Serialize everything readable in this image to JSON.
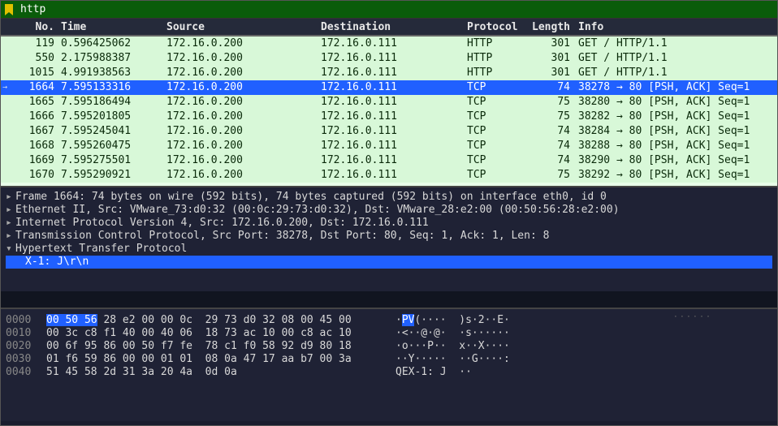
{
  "filter": {
    "value": "http"
  },
  "columns": {
    "no": "No.",
    "time": "Time",
    "source": "Source",
    "destination": "Destination",
    "protocol": "Protocol",
    "length": "Length",
    "info": "Info"
  },
  "packets": [
    {
      "no": "119",
      "time": "0.596425062",
      "src": "172.16.0.200",
      "dst": "172.16.0.111",
      "proto": "HTTP",
      "len": "301",
      "info": "GET / HTTP/1.1",
      "selected": false
    },
    {
      "no": "550",
      "time": "2.175988387",
      "src": "172.16.0.200",
      "dst": "172.16.0.111",
      "proto": "HTTP",
      "len": "301",
      "info": "GET / HTTP/1.1",
      "selected": false
    },
    {
      "no": "1015",
      "time": "4.991938563",
      "src": "172.16.0.200",
      "dst": "172.16.0.111",
      "proto": "HTTP",
      "len": "301",
      "info": "GET / HTTP/1.1",
      "selected": false
    },
    {
      "no": "1664",
      "time": "7.595133316",
      "src": "172.16.0.200",
      "dst": "172.16.0.111",
      "proto": "TCP",
      "len": "74",
      "info": "38278 → 80 [PSH, ACK] Seq=1",
      "selected": true,
      "marker": "→"
    },
    {
      "no": "1665",
      "time": "7.595186494",
      "src": "172.16.0.200",
      "dst": "172.16.0.111",
      "proto": "TCP",
      "len": "75",
      "info": "38280 → 80 [PSH, ACK] Seq=1",
      "selected": false
    },
    {
      "no": "1666",
      "time": "7.595201805",
      "src": "172.16.0.200",
      "dst": "172.16.0.111",
      "proto": "TCP",
      "len": "75",
      "info": "38282 → 80 [PSH, ACK] Seq=1",
      "selected": false
    },
    {
      "no": "1667",
      "time": "7.595245041",
      "src": "172.16.0.200",
      "dst": "172.16.0.111",
      "proto": "TCP",
      "len": "74",
      "info": "38284 → 80 [PSH, ACK] Seq=1",
      "selected": false
    },
    {
      "no": "1668",
      "time": "7.595260475",
      "src": "172.16.0.200",
      "dst": "172.16.0.111",
      "proto": "TCP",
      "len": "74",
      "info": "38288 → 80 [PSH, ACK] Seq=1",
      "selected": false
    },
    {
      "no": "1669",
      "time": "7.595275501",
      "src": "172.16.0.200",
      "dst": "172.16.0.111",
      "proto": "TCP",
      "len": "74",
      "info": "38290 → 80 [PSH, ACK] Seq=1",
      "selected": false
    },
    {
      "no": "1670",
      "time": "7.595290921",
      "src": "172.16.0.200",
      "dst": "172.16.0.111",
      "proto": "TCP",
      "len": "75",
      "info": "38292 → 80 [PSH, ACK] Seq=1",
      "selected": false
    }
  ],
  "details": [
    {
      "exp": "▸",
      "text": "Frame 1664: 74 bytes on wire (592 bits), 74 bytes captured (592 bits) on interface eth0, id 0"
    },
    {
      "exp": "▸",
      "text": "Ethernet II, Src: VMware_73:d0:32 (00:0c:29:73:d0:32), Dst: VMware_28:e2:00 (00:50:56:28:e2:00)"
    },
    {
      "exp": "▸",
      "text": "Internet Protocol Version 4, Src: 172.16.0.200, Dst: 172.16.0.111"
    },
    {
      "exp": "▸",
      "text": "Transmission Control Protocol, Src Port: 38278, Dst Port: 80, Seq: 1, Ack: 1, Len: 8"
    },
    {
      "exp": "▾",
      "text": "Hypertext Transfer Protocol"
    }
  ],
  "detail_child": "X-1: J\\r\\n",
  "hex": [
    {
      "off": "0000",
      "b_hi": "00 50 56",
      "b_rest": " 28 e2 00 00 0c  29 73 d0 32 08 00 45 00",
      "a_pre": "·",
      "a_hi": "PV",
      "a_post": "(····  )s·2··E·"
    },
    {
      "off": "0010",
      "b_hi": "",
      "b_rest": "00 3c c8 f1 40 00 40 06  18 73 ac 10 00 c8 ac 10",
      "a_pre": "",
      "a_hi": "",
      "a_post": "·<··@·@·  ·s······"
    },
    {
      "off": "0020",
      "b_hi": "",
      "b_rest": "00 6f 95 86 00 50 f7 fe  78 c1 f0 58 92 d9 80 18",
      "a_pre": "",
      "a_hi": "",
      "a_post": "·o···P··  x··X····"
    },
    {
      "off": "0030",
      "b_hi": "",
      "b_rest": "01 f6 59 86 00 00 01 01  08 0a 47 17 aa b7 00 3a",
      "a_pre": "",
      "a_hi": "",
      "a_post": "··Y·····  ··G····:"
    },
    {
      "off": "0040",
      "b_hi": "",
      "b_rest": "51 45 58 2d 31 3a 20 4a  0d 0a",
      "a_pre": "",
      "a_hi": "",
      "a_post": "QEX-1: J  ··"
    }
  ]
}
